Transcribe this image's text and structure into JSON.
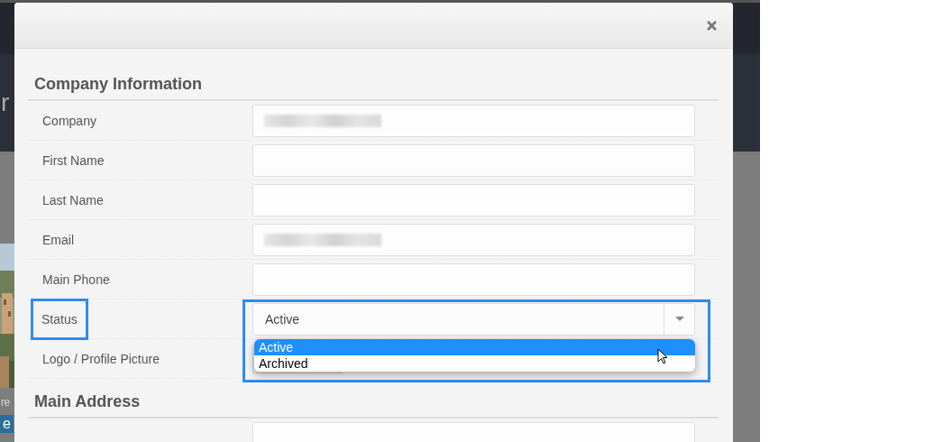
{
  "background": {
    "fragments": [
      {
        "text": "r",
        "kind": "heading"
      },
      {
        "text": "re",
        "kind": "text"
      },
      {
        "text": "e",
        "kind": "button"
      }
    ]
  },
  "modal": {
    "sections": [
      {
        "title": "Company Information",
        "fields": [
          {
            "label": "Company",
            "kind": "text",
            "redacted": true
          },
          {
            "label": "First Name",
            "kind": "text"
          },
          {
            "label": "Last Name",
            "kind": "text"
          },
          {
            "label": "Email",
            "kind": "text",
            "redacted": true
          },
          {
            "label": "Main Phone",
            "kind": "text"
          },
          {
            "label": "Status",
            "kind": "select",
            "value": "Active",
            "highlighted": true,
            "expanded": true,
            "options": [
              {
                "label": "Active",
                "selected": true
              },
              {
                "label": "Archived",
                "selected": false
              }
            ]
          },
          {
            "label": "Logo / Profile Picture",
            "kind": "file"
          }
        ]
      },
      {
        "title": "Main Address",
        "fields": [
          {
            "kind": "text"
          }
        ]
      }
    ]
  }
}
